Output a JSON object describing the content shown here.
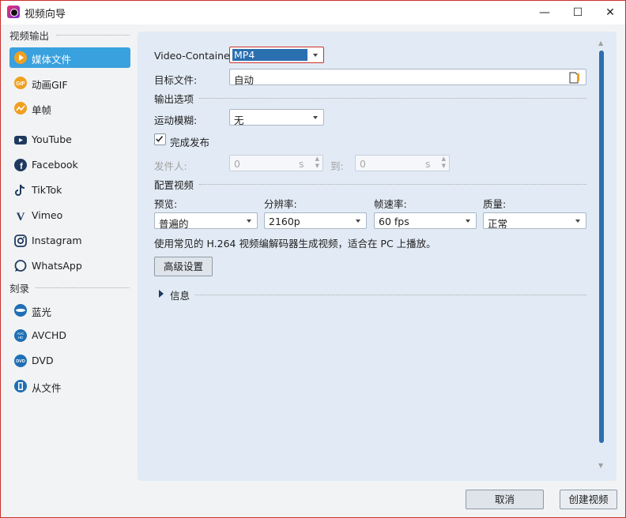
{
  "window": {
    "title": "视频向导",
    "controls": [
      "—",
      "☐",
      "✕"
    ]
  },
  "sidebar": {
    "section_output": "视频输出",
    "section_burn": "刻录",
    "items": [
      {
        "label": "媒体文件",
        "icon": "play-circle-icon",
        "color": "#f0a020"
      },
      {
        "label": "动画GIF",
        "icon": "gif-icon",
        "color": "#f0a020"
      },
      {
        "label": "单帧",
        "icon": "image-frame-icon",
        "color": "#f0a020"
      },
      {
        "label": "YouTube",
        "icon": "youtube-icon",
        "color": "#1f3a5f"
      },
      {
        "label": "Facebook",
        "icon": "facebook-icon",
        "color": "#1f3a5f"
      },
      {
        "label": "TikTok",
        "icon": "tiktok-icon",
        "color": "#1f3a5f"
      },
      {
        "label": "Vimeo",
        "icon": "vimeo-icon",
        "color": "#1f3a5f"
      },
      {
        "label": "Instagram",
        "icon": "instagram-icon",
        "color": "#1f3a5f"
      },
      {
        "label": "WhatsApp",
        "icon": "whatsapp-icon",
        "color": "#1f3a5f"
      },
      {
        "label": "蓝光",
        "icon": "bluray-icon",
        "color": "#1f6fb5"
      },
      {
        "label": "AVCHD",
        "icon": "avchd-icon",
        "color": "#1f6fb5"
      },
      {
        "label": "DVD",
        "icon": "dvd-icon",
        "color": "#1f6fb5"
      },
      {
        "label": "从文件",
        "icon": "file-disc-icon",
        "color": "#1f6fb5"
      }
    ]
  },
  "main": {
    "container_label": "Video-Container:",
    "container_value": "MP4",
    "target_label": "目标文件:",
    "target_value": "自动",
    "output_options": "输出选项",
    "motion_blur_label": "运动模糊:",
    "motion_blur_value": "无",
    "publish_label": "完成发布",
    "publish_checked": true,
    "sender_label": "发件人:",
    "sender_value": "0",
    "sender_unit": "s",
    "to_label": "到:",
    "to_value": "0",
    "to_unit": "s",
    "config_video": "配置视频",
    "preset_label": "预览:",
    "preset_value": "普遍的",
    "resolution_label": "分辨率:",
    "resolution_value": "2160p",
    "framerate_label": "帧速率:",
    "framerate_value": "60 fps",
    "quality_label": "质量:",
    "quality_value": "正常",
    "description": "使用常见的 H.264 视频编解码器生成视频，适合在 PC 上播放。",
    "advanced_button": "高级设置",
    "info_label": "信息"
  },
  "footer": {
    "cancel": "取消",
    "create": "创建视频"
  },
  "colors": {
    "accent": "#39a1de",
    "panel": "#e2ebf5",
    "scroll": "#2a6fb0"
  }
}
